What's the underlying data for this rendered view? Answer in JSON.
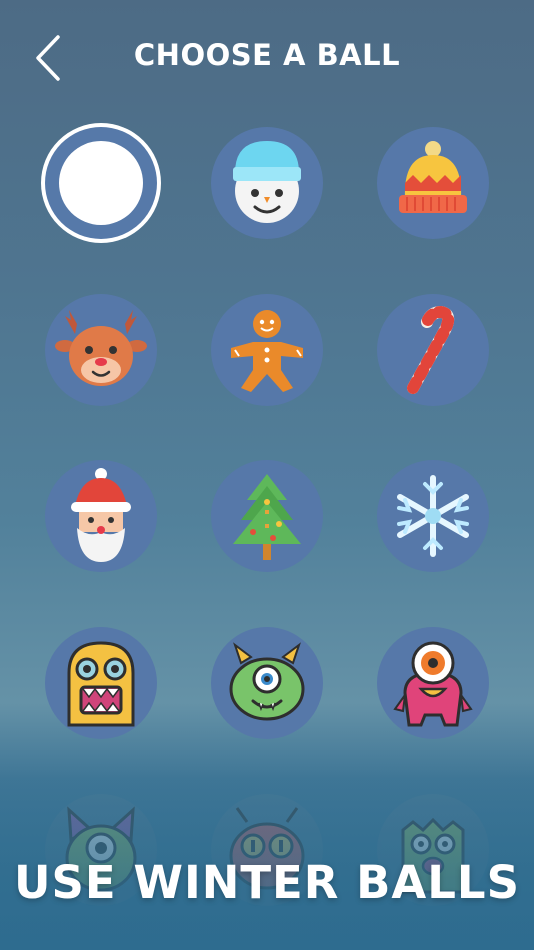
{
  "header": {
    "title": "CHOOSE A BALL",
    "back_icon": "chevron-left-icon"
  },
  "balls": [
    {
      "name": "plain-white",
      "icon": "plain-ball-icon",
      "selected": true
    },
    {
      "name": "snowman",
      "icon": "snowman-icon"
    },
    {
      "name": "winter-hat",
      "icon": "winter-hat-icon"
    },
    {
      "name": "reindeer",
      "icon": "reindeer-icon"
    },
    {
      "name": "gingerbread-man",
      "icon": "gingerbread-man-icon"
    },
    {
      "name": "candy-cane",
      "icon": "candy-cane-icon"
    },
    {
      "name": "santa",
      "icon": "santa-icon"
    },
    {
      "name": "christmas-tree",
      "icon": "christmas-tree-icon"
    },
    {
      "name": "snowflake",
      "icon": "snowflake-icon"
    },
    {
      "name": "yellow-monster",
      "icon": "yellow-monster-icon"
    },
    {
      "name": "green-horned-monster",
      "icon": "green-monster-icon"
    },
    {
      "name": "pink-cyclops-monster",
      "icon": "pink-monster-icon"
    },
    {
      "name": "cat-monster",
      "icon": "cat-monster-icon"
    },
    {
      "name": "antenna-monster",
      "icon": "antenna-monster-icon"
    },
    {
      "name": "green-furry-monster",
      "icon": "furry-monster-icon"
    }
  ],
  "banner": {
    "text": "USE WINTER BALLS"
  },
  "colors": {
    "ball_bg": "#5678a9",
    "accent_white": "#ffffff"
  }
}
